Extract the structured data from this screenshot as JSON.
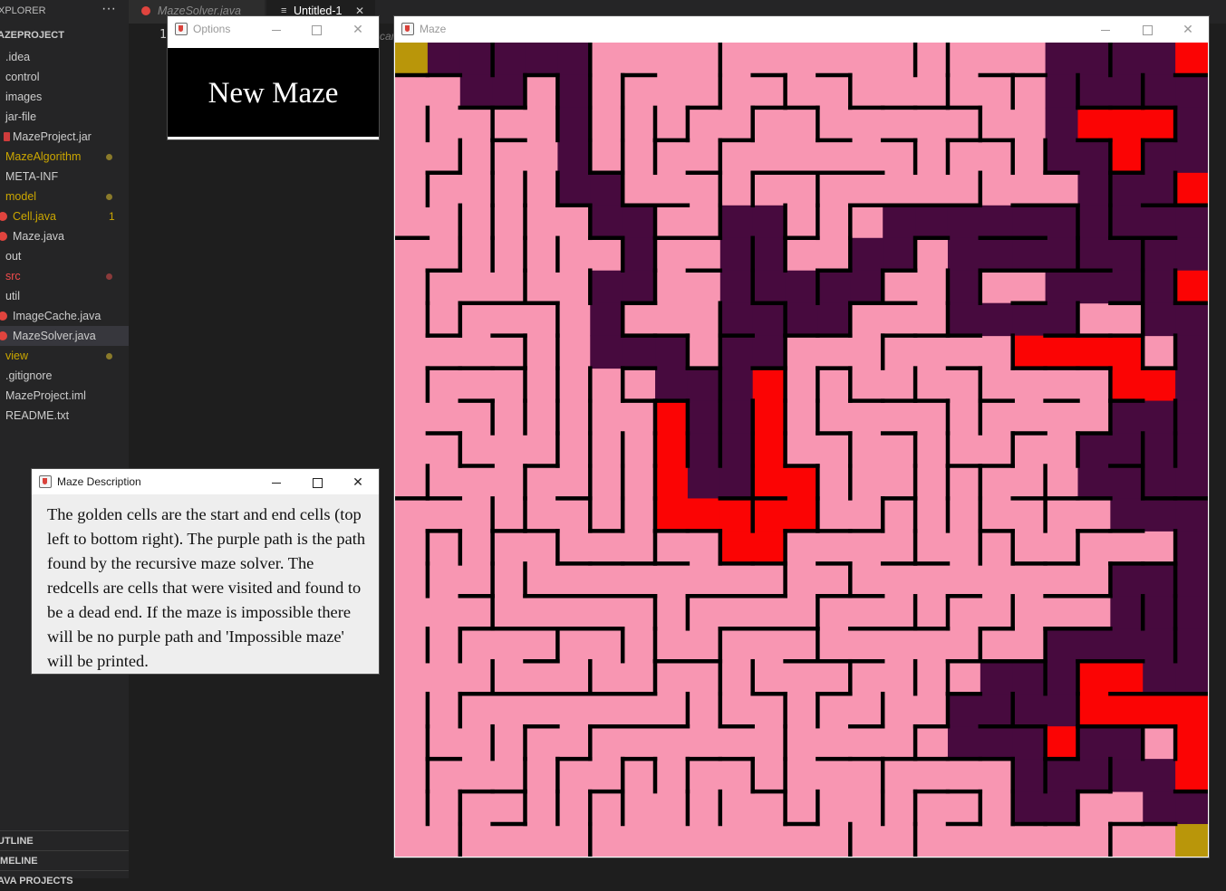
{
  "sidebar": {
    "title": "XPLORER",
    "more_label": "···",
    "project": "AZEPROJECT",
    "items": [
      {
        "label": ".idea",
        "color": "#cccccc"
      },
      {
        "label": "control",
        "color": "#cccccc"
      },
      {
        "label": "images",
        "color": "#cccccc"
      },
      {
        "label": "jar-file",
        "color": "#cccccc"
      },
      {
        "label": "MazeProject.jar",
        "color": "#cccccc",
        "icon": "jar-file-icon"
      },
      {
        "label": "MazeAlgorithm",
        "color": "#cca700",
        "dot": "#8a7a2a"
      },
      {
        "label": "META-INF",
        "color": "#cccccc"
      },
      {
        "label": "model",
        "color": "#cca700",
        "dot": "#8a7a2a"
      },
      {
        "label": "Cell.java",
        "color": "#cca700",
        "icon": "java-file-icon",
        "count": "1"
      },
      {
        "label": "Maze.java",
        "color": "#cccccc",
        "icon": "java-file-icon"
      },
      {
        "label": "out",
        "color": "#cccccc"
      },
      {
        "label": "src",
        "color": "#f14c4c",
        "dot": "#8a3a3a"
      },
      {
        "label": "util",
        "color": "#cccccc"
      },
      {
        "label": "ImageCache.java",
        "color": "#cccccc",
        "icon": "java-file-icon"
      },
      {
        "label": "MazeSolver.java",
        "color": "#cccccc",
        "icon": "java-file-icon",
        "selected": true
      },
      {
        "label": "view",
        "color": "#cca700",
        "dot": "#8a7a2a"
      },
      {
        "label": ".gitignore",
        "color": "#cccccc"
      },
      {
        "label": "MazeProject.iml",
        "color": "#cccccc"
      },
      {
        "label": "README.txt",
        "color": "#cccccc"
      }
    ],
    "panels": [
      "UTLINE",
      "IMELINE",
      "AVA PROJECTS"
    ]
  },
  "tabs": [
    {
      "label": "MazeSolver.java",
      "icon": "java-file-icon",
      "active": false
    },
    {
      "label": "Untitled-1",
      "icon": "text-file-icon",
      "close": "✕",
      "active": true
    }
  ],
  "editor": {
    "line_number": "1",
    "peek_text": "car"
  },
  "options_window": {
    "title": "Options",
    "button_label": "New Maze"
  },
  "description_window": {
    "title": "Maze Description",
    "text": "The golden cells are the start and end cells (top left to bottom right). The purple path is the path found by the recursive maze solver. The redcells are cells that were visited and found to be a dead end. If the maze is impossible there will be no purple path and 'Impossible maze' will be printed."
  },
  "maze_window": {
    "title": "Maze",
    "grid": {
      "cols": 25,
      "rows": 25
    },
    "colors": {
      "open": "#f896b2",
      "wall": "#000000",
      "path": "#470a3e",
      "dead_end": "#fb0404",
      "start_end": "#b9960a",
      "background": "#f896b2"
    },
    "start_cell": [
      0,
      0
    ],
    "end_cell": [
      24,
      24
    ]
  }
}
